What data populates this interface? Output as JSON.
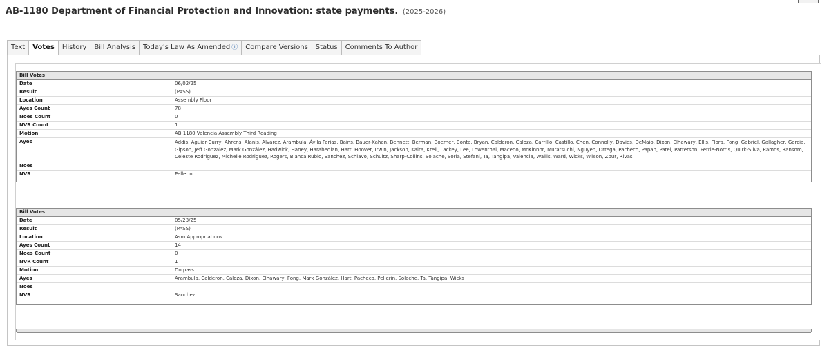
{
  "header": {
    "title": "AB-1180 Department of Financial Protection and Innovation: state payments.",
    "session": "(2025-2026)"
  },
  "tabs": [
    {
      "label": "Text",
      "active": false
    },
    {
      "label": "Votes",
      "active": true
    },
    {
      "label": "History",
      "active": false
    },
    {
      "label": "Bill Analysis",
      "active": false
    },
    {
      "label": "Today's Law As Amended",
      "active": false,
      "icon": "info-icon"
    },
    {
      "label": "Compare Versions",
      "active": false
    },
    {
      "label": "Status",
      "active": false
    },
    {
      "label": "Comments To Author",
      "active": false
    }
  ],
  "info_glyph": "ⓘ",
  "votes": [
    {
      "heading": "Bill Votes",
      "rows": [
        {
          "label": "Date",
          "value": "06/02/25"
        },
        {
          "label": "Result",
          "value": "(PASS)"
        },
        {
          "label": "Location",
          "value": "Assembly Floor"
        },
        {
          "label": "Ayes Count",
          "value": "78"
        },
        {
          "label": "Noes Count",
          "value": "0"
        },
        {
          "label": "NVR Count",
          "value": "1"
        },
        {
          "label": "Motion",
          "value": "AB 1180 Valencia Assembly Third Reading"
        },
        {
          "label": "Ayes",
          "value": "Addis, Aguiar-Curry, Ahrens, Alanis, Alvarez, Arambula, Ávila Farías, Bains, Bauer-Kahan, Bennett, Berman, Boerner, Bonta, Bryan, Calderon, Caloza, Carrillo, Castillo, Chen, Connolly, Davies, DeMaio, Dixon, Elhawary, Ellis, Flora, Fong, Gabriel, Gallagher, Garcia, Gipson, Jeff Gonzalez, Mark González, Hadwick, Haney, Harabedian, Hart, Hoover, Irwin, Jackson, Kalra, Krell, Lackey, Lee, Lowenthal, Macedo, McKinnor, Muratsuchi, Nguyen, Ortega, Pacheco, Papan, Patel, Patterson, Petrie-Norris, Quirk-Silva, Ramos, Ransom, Celeste Rodriguez, Michelle Rodriguez, Rogers, Blanca Rubio, Sanchez, Schiavo, Schultz, Sharp-Collins, Solache, Soria, Stefani, Ta, Tangipa, Valencia, Wallis, Ward, Wicks, Wilson, Zbur, Rivas"
        },
        {
          "label": "Noes",
          "value": ""
        },
        {
          "label": "NVR",
          "value": "Pellerin"
        }
      ]
    },
    {
      "heading": "Bill Votes",
      "rows": [
        {
          "label": "Date",
          "value": "05/23/25"
        },
        {
          "label": "Result",
          "value": "(PASS)"
        },
        {
          "label": "Location",
          "value": "Asm Appropriations"
        },
        {
          "label": "Ayes Count",
          "value": "14"
        },
        {
          "label": "Noes Count",
          "value": "0"
        },
        {
          "label": "NVR Count",
          "value": "1"
        },
        {
          "label": "Motion",
          "value": "Do pass."
        },
        {
          "label": "Ayes",
          "value": "Arambula, Calderon, Caloza, Dixon, Elhawary, Fong, Mark González, Hart, Pacheco, Pellerin, Solache, Ta, Tangipa, Wicks"
        },
        {
          "label": "Noes",
          "value": ""
        },
        {
          "label": "NVR",
          "value": "Sanchez"
        }
      ]
    }
  ]
}
